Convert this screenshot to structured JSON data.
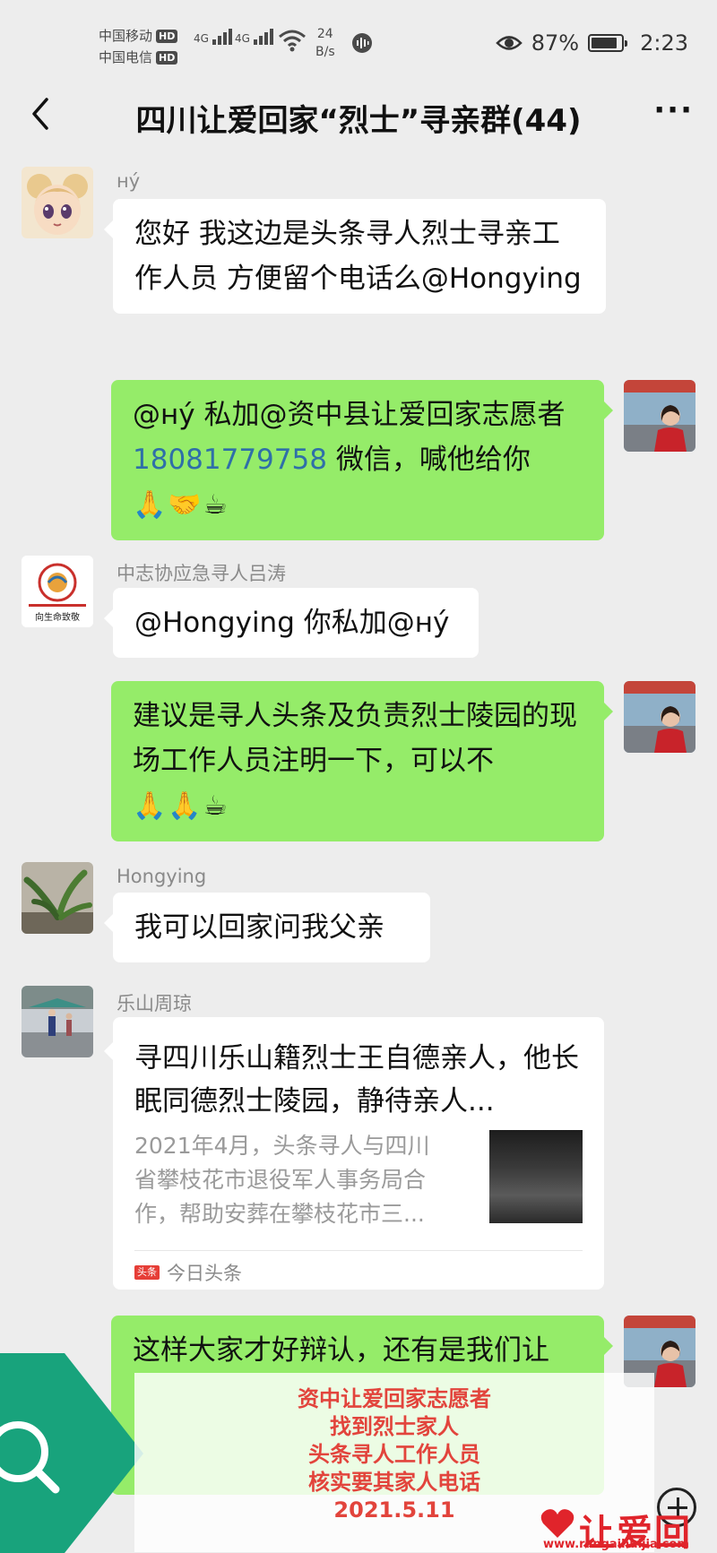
{
  "status": {
    "carrier1": "中国移动",
    "carrier2": "中国电信",
    "hd": "HD",
    "net1": "4G",
    "net2": "4G",
    "speed_value": "24",
    "speed_unit": "B/s",
    "battery": "87%",
    "battery_level": 0.87,
    "time": "2:23"
  },
  "nav": {
    "title": "四川让爱回家“烈士”寻亲群(44)",
    "more": "···"
  },
  "messages": [
    {
      "sender": "нý",
      "text": "您好 我这边是头条寻人烈士寻亲工作人员 方便留个电话么@Hongying"
    },
    {
      "text_a": "@нý 私加@资中县让爱回家志愿者",
      "phone": "18081779758",
      "text_b": " 微信，喊他给你",
      "emoji": "🙏🤝☕"
    },
    {
      "sender": "中志协应急寻人吕涛",
      "text": "@Hongying 你私加@нý"
    },
    {
      "text": "建议是寻人头条及负责烈士陵园的现场工作人员注明一下，可以不",
      "emoji": "🙏🙏☕"
    },
    {
      "sender": "Hongying",
      "text": "我可以回家问我父亲"
    },
    {
      "sender": "乐山周琼"
    },
    {
      "text": "这样大家才好辩认，还有是我们让"
    }
  ],
  "card": {
    "title": "寻四川乐山籍烈士王自德亲人，他长眠同德烈士陵园，静待亲人...",
    "desc": "2021年4月，头条寻人与四川省攀枝花市退役军人事务局合作，帮助安葬在攀枝花市三...",
    "source_badge": "头条",
    "source": "今日头条"
  },
  "avatar_text": "向生命致敬",
  "overlay": {
    "line1": "资中让爱回家志愿者",
    "line2": "找到烈士家人",
    "line3": "头条寻人工作人员",
    "line4": "核实要其家人电话",
    "line5": "2021.5.11"
  },
  "watermark": {
    "name": "让爱回家",
    "url": "www.rangaihuijia.com"
  }
}
